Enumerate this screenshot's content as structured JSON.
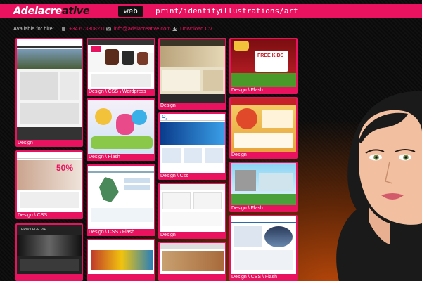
{
  "header": {
    "logo_a": "Adelacre",
    "logo_b": "ative",
    "nav": [
      "web",
      "print/identity",
      "illustrations/art"
    ],
    "active_nav": "web",
    "accent": "#e8125e"
  },
  "hire_bar": {
    "label": "Available for hire:",
    "phone": "+34 673308211",
    "email": "info@adelacreative.com",
    "download": "Download CV",
    "icons": [
      "phone-icon",
      "email-icon",
      "download-icon"
    ]
  },
  "portfolio": [
    {
      "caption": "Design"
    },
    {
      "caption": "Design \\ CSS \\ Wordpress"
    },
    {
      "caption": "Design"
    },
    {
      "caption": "Design \\ Flash"
    },
    {
      "caption": "Design \\ Flash"
    },
    {
      "caption": "Design \\ Css"
    },
    {
      "caption": "Design"
    },
    {
      "caption": "Design \\ CSS"
    },
    {
      "caption": "Design \\ CSS \\ Flash"
    },
    {
      "caption": "Design"
    },
    {
      "caption": "Design \\ Flash"
    },
    {
      "caption": "Design \\ CSS \\ Flash"
    },
    {
      "caption": ""
    },
    {
      "caption": ""
    },
    {
      "caption": ""
    }
  ],
  "thumb_texts": {
    "free_kids": "FREE KIDS",
    "sale": "50%",
    "privilege": "PRIVILEGE VIP"
  }
}
